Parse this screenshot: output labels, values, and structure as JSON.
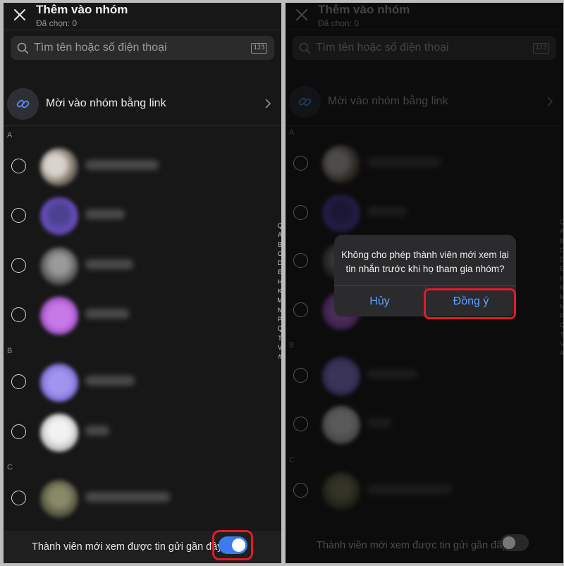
{
  "header": {
    "title": "Thêm vào nhóm",
    "subtitle": "Đã chọn: 0"
  },
  "search": {
    "placeholder": "Tìm tên hoặc số điện thoại",
    "keypad_label": "123"
  },
  "invite": {
    "label": "Mời vào nhóm bằng link"
  },
  "sections": [
    "A",
    "B",
    "C"
  ],
  "alpha_index": [
    "Q",
    "A",
    "B",
    "C",
    "D",
    "E",
    "H",
    "K",
    "M",
    "N",
    "P",
    "Q",
    "T",
    "V",
    "#"
  ],
  "footer": {
    "label": "Thành viên mới xem được tin gửi gần đây",
    "toggle_on_left": true,
    "toggle_on_right": false
  },
  "dialog": {
    "message": "Không cho phép thành viên mới xem lại tin nhắn trước khi họ tham gia nhóm?",
    "cancel": "Hủy",
    "confirm": "Đồng ý"
  },
  "colors": {
    "accent": "#3a7cf0",
    "link_blue": "#5fa0ff",
    "highlight": "#e11b2a"
  }
}
